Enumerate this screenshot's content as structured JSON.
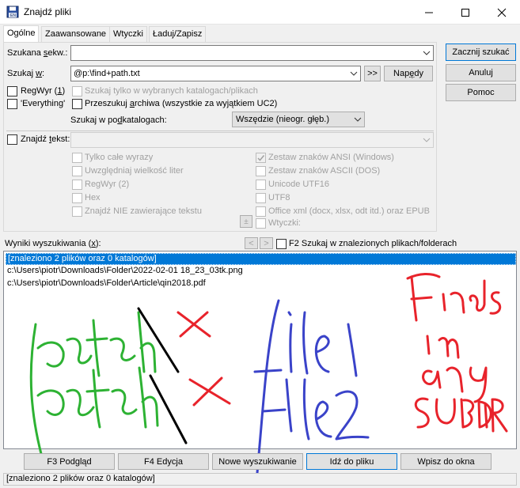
{
  "window": {
    "title": "Znajdź pliki",
    "controls": {
      "minimize": "minimize-icon",
      "maximize": "maximize-icon",
      "close": "close-icon"
    }
  },
  "tabs": [
    {
      "label": "Ogólne",
      "active": true
    },
    {
      "label": "Zaawansowane",
      "active": false
    },
    {
      "label": "Wtyczki",
      "active": false
    },
    {
      "label": "Ładuj/Zapisz",
      "active": false
    }
  ],
  "general": {
    "search_for_label": "Szukana sekw.:",
    "search_for_value": "",
    "search_in_label": "Szukaj w:",
    "search_in_value": "@p:\\find+path.txt",
    "browse_label": ">>",
    "drives_label": "Napędy",
    "regex_label": "RegWyr (1)",
    "everything_label": "'Everything'",
    "only_selected_label": "Szukaj tylko w wybranych katalogach/plikach",
    "archives_label": "Przeszukuj archiwa (wszystkie za wyjątkiem UC2)",
    "subdirs_label": "Szukaj w podkatalogach:",
    "subdirs_value": "Wszędzie (nieogr. głęb.)",
    "find_text_label": "Znajdź tekst:",
    "find_text_value": "",
    "whole_words": "Tylko całe wyrazy",
    "case_sensitive": "Uwzględniaj wielkość liter",
    "regex2": "RegWyr (2)",
    "hex": "Hex",
    "not_containing": "Znajdź NIE zawierające tekstu",
    "ansi": "Zestaw znaków ANSI (Windows)",
    "ascii": "Zestaw znaków ASCII (DOS)",
    "utf16": "Unicode UTF16",
    "utf8": "UTF8",
    "office": "Office xml (docx, xlsx, odt itd.) oraz EPUB",
    "plugins_label": "Wtyczki:",
    "plus_label": "±"
  },
  "side_buttons": {
    "start": "Zacznij szukać",
    "cancel": "Anuluj",
    "help": "Pomoc"
  },
  "results": {
    "label": "Wyniki wyszukiwania (x):",
    "prev": "<",
    "next": ">",
    "f2_label": "F2 Szukaj w znalezionych plikach/folderach",
    "rows": [
      "[znaleziono 2 plików oraz 0 katalogów]",
      "c:\\Users\\piotr\\Downloads\\Folder\\2022-02-01 18_23_03tk.png",
      "c:\\Users\\piotr\\Downloads\\Folder\\Article\\qin2018.pdf"
    ]
  },
  "annotations": {
    "green_text": [
      "match",
      "match"
    ],
    "blue_text": [
      "file1",
      "file2"
    ],
    "red_text": [
      "Finds",
      "in",
      "any",
      "SUBDIR"
    ],
    "colors": {
      "green": "#2db233",
      "black": "#000000",
      "red": "#e8232b",
      "blue": "#3a43c9"
    }
  },
  "bottom_buttons": {
    "view": "F3 Podgląd",
    "edit": "F4 Edycja",
    "new_search": "Nowe wyszukiwanie",
    "goto": "Idź do pliku",
    "feed": "Wpisz do okna"
  },
  "status": "[znaleziono 2 plików oraz 0 katalogów]",
  "colors": {
    "selection": "#0078d7",
    "default_border": "#0078d7"
  }
}
